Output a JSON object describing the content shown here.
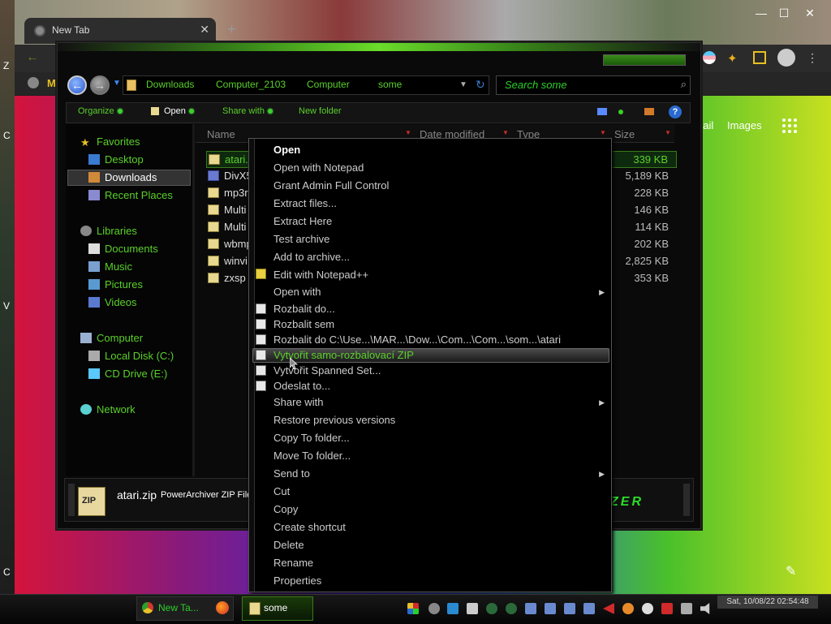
{
  "browser": {
    "tab_title": "New Tab",
    "tab_close": "✕",
    "new_tab": "+",
    "min": "—",
    "max": "☐",
    "close": "✕",
    "back": "←",
    "gmail": "nail",
    "images": "Images",
    "edit": "✎",
    "bookmark_letter": "M"
  },
  "desktop": {
    "labels": [
      "Z",
      "C",
      "V",
      "C"
    ]
  },
  "explorer": {
    "nav_back": "←",
    "nav_forward": "→",
    "breadcrumb": [
      "Downloads",
      "Computer_2103",
      "Computer",
      "some"
    ],
    "address_dropdown": "▼",
    "refresh": "↻",
    "search_placeholder": "Search some",
    "toolbar": {
      "organize": "Organize",
      "open": "Open",
      "share_with": "Share with",
      "new_folder": "New folder",
      "help": "?"
    },
    "nav_pane": {
      "favorites": "Favorites",
      "desktop": "Desktop",
      "downloads": "Downloads",
      "recent_places": "Recent Places",
      "libraries": "Libraries",
      "documents": "Documents",
      "music": "Music",
      "pictures": "Pictures",
      "videos": "Videos",
      "computer": "Computer",
      "local_disk": "Local Disk (C:)",
      "cd_drive": "CD Drive (E:)",
      "network": "Network"
    },
    "columns": {
      "name": "Name",
      "date_modified": "Date modified",
      "type": "Type",
      "size": "Size"
    },
    "files": [
      {
        "name": "atari.",
        "size": "339 KB"
      },
      {
        "name": "DivX5",
        "size": "5,189 KB"
      },
      {
        "name": "mp3r",
        "size": "228 KB"
      },
      {
        "name": "Multi",
        "size": "146 KB"
      },
      {
        "name": "Multi",
        "size": "114 KB"
      },
      {
        "name": "wbmp",
        "size": "202 KB"
      },
      {
        "name": "winvi",
        "size": "2,825 KB"
      },
      {
        "name": "zxsp",
        "size": "353 KB"
      }
    ],
    "details": {
      "icon_text": "ZIP",
      "filename": "atari.zip",
      "filetype": "PowerArchiver ZIP File",
      "brand": "ZER"
    }
  },
  "context_menu": {
    "open": "Open",
    "open_notepad": "Open with Notepad",
    "grant_admin": "Grant Admin Full Control",
    "extract_files": "Extract files...",
    "extract_here": "Extract Here",
    "test_archive": "Test archive",
    "add_to_archive": "Add to archive...",
    "edit_notepadpp": "Edit with Notepad++",
    "open_with": "Open with",
    "rozbalit_do": "Rozbalit do...",
    "rozbalit_sem": "Rozbalit sem",
    "rozbalit_path": "Rozbalit do C:\\Use...\\MAR...\\Dow...\\Com...\\Com...\\som...\\atari",
    "vytvorit_zip": "Vytvořit samo-rozbalovací ZIP",
    "vytvorit_spanned": "Vytvořit Spanned Set...",
    "odeslat": "Odeslat to...",
    "share_with": "Share with",
    "restore": "Restore previous versions",
    "copy_to": "Copy To folder...",
    "move_to": "Move To folder...",
    "send_to": "Send to",
    "cut": "Cut",
    "copy": "Copy",
    "create_shortcut": "Create shortcut",
    "delete": "Delete",
    "rename": "Rename",
    "properties": "Properties",
    "submenu_arrow": "▶"
  },
  "taskbar": {
    "chrome_label": "New Ta...",
    "explorer_label": "some",
    "clock": "Sat, 10/08/22 02:54:48"
  },
  "colors": {
    "accent_green": "#5ad02a",
    "highlight_green": "#2ad02a"
  }
}
